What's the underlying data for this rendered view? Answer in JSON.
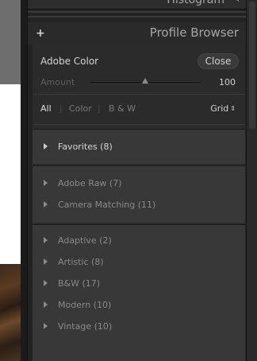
{
  "histogram": {
    "title": "Histogram"
  },
  "profile_browser": {
    "header_title": "Profile Browser",
    "add_label": "+",
    "current_profile": "Adobe Color",
    "close_label": "Close",
    "amount_label": "Amount",
    "amount_value": "100",
    "amount_fraction": 1.0,
    "filters": [
      {
        "label": "All",
        "active": true
      },
      {
        "label": "Color",
        "active": false
      },
      {
        "label": "B & W",
        "active": false
      }
    ],
    "view_label": "Grid",
    "view_arrows": "⇕",
    "group1": [
      {
        "label": "Favorites (8)"
      }
    ],
    "group2": [
      {
        "label": "Adobe Raw (7)"
      },
      {
        "label": "Camera Matching (11)"
      }
    ],
    "group3": [
      {
        "label": "Adaptive (2)"
      },
      {
        "label": "Artistic (8)"
      },
      {
        "label": "B&W (17)"
      },
      {
        "label": "Modern (10)"
      },
      {
        "label": "Vintage (10)"
      }
    ]
  }
}
